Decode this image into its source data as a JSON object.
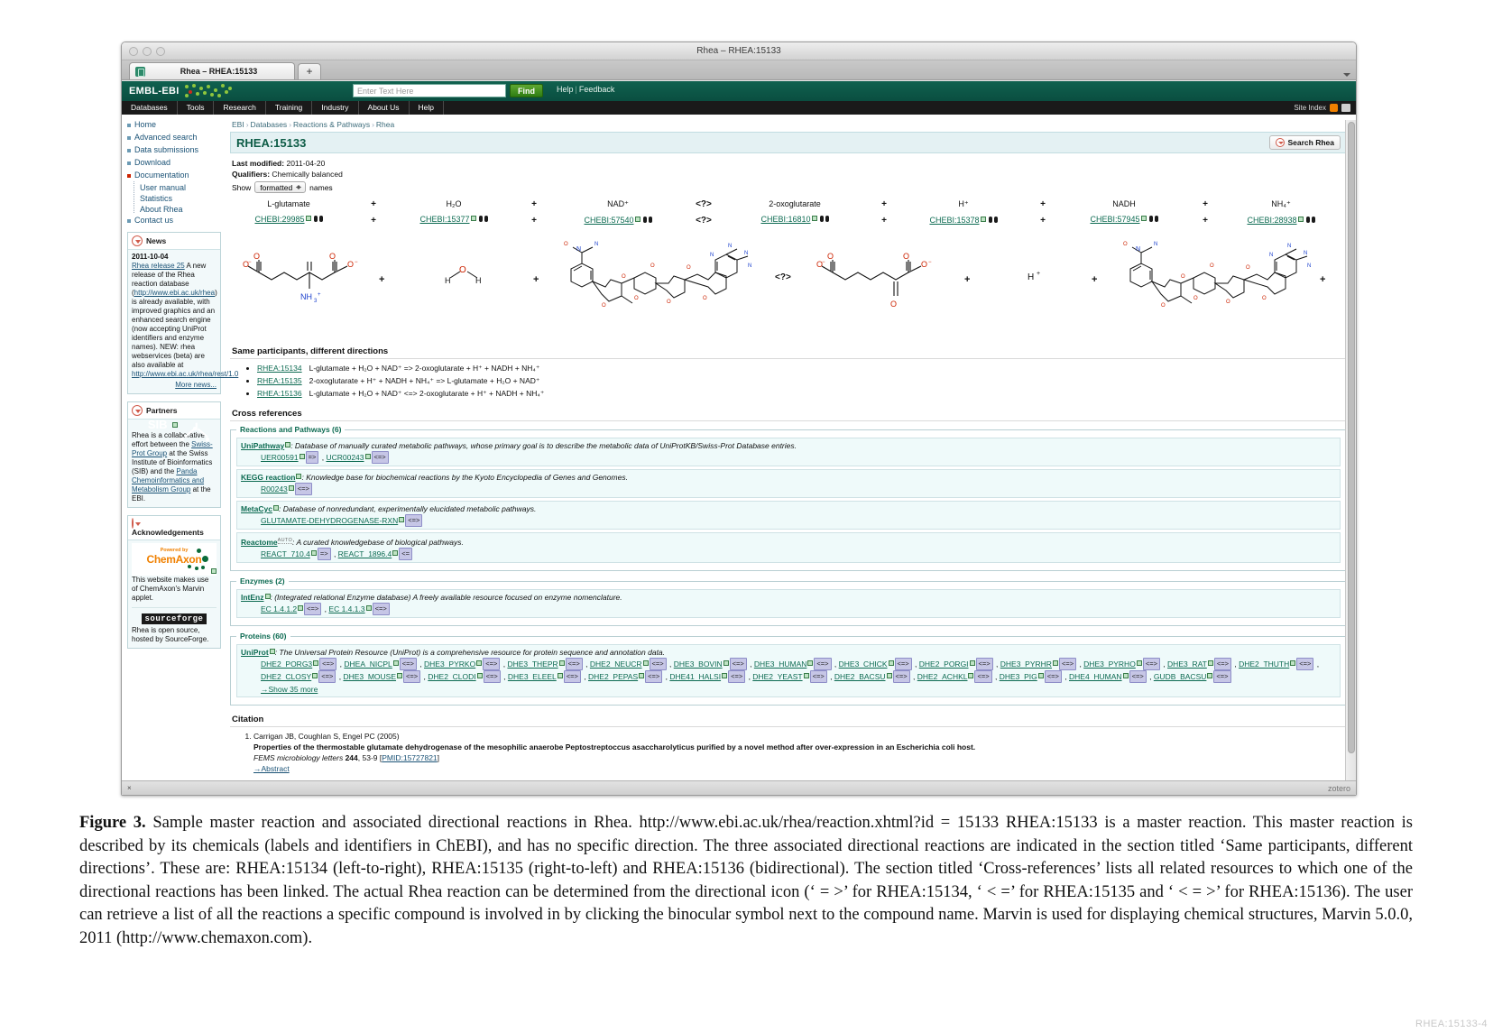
{
  "window": {
    "title": "Rhea – RHEA:15133",
    "tab_label": "Rhea – RHEA:15133",
    "new_tab_label": "+"
  },
  "ebi_header": {
    "logo": "EMBL-EBI",
    "search_placeholder": "Enter Text Here",
    "find_label": "Find",
    "help_label": "Help",
    "feedback_label": "Feedback",
    "nav": [
      "Databases",
      "Tools",
      "Research",
      "Training",
      "Industry",
      "About Us",
      "Help"
    ],
    "site_index_label": "Site Index"
  },
  "sidebar": {
    "links": [
      {
        "label": "Home",
        "active": false
      },
      {
        "label": "Advanced search",
        "active": false
      },
      {
        "label": "Data submissions",
        "active": false
      },
      {
        "label": "Download",
        "active": false
      },
      {
        "label": "Documentation",
        "active": true
      }
    ],
    "sublinks": [
      "User manual",
      "Statistics",
      "About Rhea"
    ],
    "contact": "Contact us",
    "news": {
      "title": "News",
      "date": "2011-10-04",
      "headline": "Rhea release 25",
      "text_1": "A new release of the Rhea reaction database (",
      "url_1": "http://www.ebi.ac.uk/rhea",
      "text_2": ") is already available, with improved graphics and an enhanced search engine (now accepting UniProt identifiers and enzyme names). NEW: rhea webservices (beta) are also available at ",
      "url_2": "http://www.ebi.ac.uk/rhea/rest/1.0",
      "more": "More news..."
    },
    "partners": {
      "title": "Partners",
      "logo_text": "SIB",
      "text_1": "Rhea is a collaborative effort between the ",
      "link_1": "Swiss-Prot Group",
      "text_2": " at the Swiss Institute of Bioinformatics (SIB) and the ",
      "link_2": "Panda Chemoinformatics and Metabolism Group",
      "text_3": " at the EBI."
    },
    "acknowledgements": {
      "title": "Acknowledgements",
      "powered_by": "Powered by",
      "brand": "ChemAxon",
      "text": "This website makes use of ChemAxon's Marvin applet.",
      "sourceforge_logo": "sourceforge",
      "sourceforge_text": "Rhea is open source, hosted by SourceForge."
    }
  },
  "main": {
    "breadcrumb": [
      "EBI",
      "Databases",
      "Reactions & Pathways",
      "Rhea"
    ],
    "page_title": "RHEA:15133",
    "search_rhea_label": "Search Rhea",
    "last_modified_label": "Last modified:",
    "last_modified_value": "2011-04-20",
    "qualifiers_label": "Qualifiers:",
    "qualifiers_value": "Chemically balanced",
    "show_label": "Show",
    "show_select_value": "formatted",
    "names_label": "names",
    "equation": {
      "left": [
        {
          "name": "L-glutamate",
          "id": "CHEBI:29985"
        },
        {
          "name": "H₂O",
          "id": "CHEBI:15377"
        },
        {
          "name": "NAD⁺",
          "id": "CHEBI:57540"
        }
      ],
      "direction": "<?>",
      "right": [
        {
          "name": "2-oxoglutarate",
          "id": "CHEBI:16810"
        },
        {
          "name": "H⁺",
          "id": "CHEBI:15378"
        },
        {
          "name": "NADH",
          "id": "CHEBI:57945"
        },
        {
          "name": "NH₄⁺",
          "id": "CHEBI:28938"
        }
      ],
      "plus": "+"
    },
    "directions_section": {
      "title": "Same participants, different directions",
      "items": [
        {
          "id": "RHEA:15134",
          "equation": "L-glutamate + H₂O + NAD⁺ => 2-oxoglutarate + H⁺ + NADH + NH₄⁺"
        },
        {
          "id": "RHEA:15135",
          "equation": "2-oxoglutarate + H⁺ + NADH + NH₄⁺ => L-glutamate + H₂O + NAD⁺"
        },
        {
          "id": "RHEA:15136",
          "equation": "L-glutamate + H₂O + NAD⁺ <=> 2-oxoglutarate + H⁺ + NADH + NH₄⁺"
        }
      ]
    },
    "cross_references": {
      "title": "Cross references",
      "groups": [
        {
          "legend": "Reactions and Pathways (6)",
          "rows": [
            {
              "db": "UniPathway",
              "desc": ": Database of manually curated metabolic pathways, whose primary goal is to describe the metabolic data of UniProtKB/Swiss-Prot Database entries.",
              "ids": [
                {
                  "id": "UER00591",
                  "dir": "=>"
                },
                {
                  "id": "UCR00243",
                  "dir": "<=>"
                }
              ]
            },
            {
              "db": "KEGG reaction",
              "desc": ": Knowledge base for biochemical reactions by the Kyoto Encyclopedia of Genes and Genomes.",
              "ids": [
                {
                  "id": "R00243",
                  "dir": "<=>"
                }
              ]
            },
            {
              "db": "MetaCyc",
              "desc": ": Database of nonredundant, experimentally elucidated metabolic pathways.",
              "ids": [
                {
                  "id": "GLUTAMATE-DEHYDROGENASE-RXN",
                  "dir": "<=>"
                }
              ]
            },
            {
              "db": "Reactome",
              "auto": "AUTO",
              "desc": ": A curated knowledgebase of biological pathways.",
              "ids": [
                {
                  "id": "REACT_710.4",
                  "dir": "=>"
                },
                {
                  "id": "REACT_1896.4",
                  "dir": "<="
                }
              ]
            }
          ]
        },
        {
          "legend": "Enzymes (2)",
          "rows": [
            {
              "db": "IntEnz",
              "desc": ": (Integrated relational Enzyme database) A freely available resource focused on enzyme nomenclature.",
              "ids": [
                {
                  "id": "EC 1.4.1.2",
                  "dir": "<=>"
                },
                {
                  "id": "EC 1.4.1.3",
                  "dir": "<=>"
                }
              ]
            }
          ]
        },
        {
          "legend": "Proteins (60)",
          "rows": [
            {
              "db": "UniProt",
              "desc": ": The Universal Protein Resource (UniProt) is a comprehensive resource for protein sequence and annotation data.",
              "ids": [
                {
                  "id": "DHE2_PORG3",
                  "dir": "<=>"
                },
                {
                  "id": "DHEA_NICPL",
                  "dir": "<=>"
                },
                {
                  "id": "DHE3_PYRKO",
                  "dir": "<=>"
                },
                {
                  "id": "DHE3_THEPR",
                  "dir": "<=>"
                },
                {
                  "id": "DHE2_NEUCR",
                  "dir": "<=>"
                },
                {
                  "id": "DHE3_BOVIN",
                  "dir": "<=>"
                },
                {
                  "id": "DHE3_HUMAN",
                  "dir": "<=>"
                },
                {
                  "id": "DHE3_CHICK",
                  "dir": "<=>"
                },
                {
                  "id": "DHE2_PORGI",
                  "dir": "<=>"
                },
                {
                  "id": "DHE3_PYRHR",
                  "dir": "<=>"
                },
                {
                  "id": "DHE3_PYRHO",
                  "dir": "<=>"
                },
                {
                  "id": "DHE3_RAT",
                  "dir": "<=>"
                },
                {
                  "id": "DHE2_THUTH",
                  "dir": "<=>"
                },
                {
                  "id": "DHE2_CLOSY",
                  "dir": "<=>"
                },
                {
                  "id": "DHE3_MOUSE",
                  "dir": "<=>"
                },
                {
                  "id": "DHE2_CLODI",
                  "dir": "<=>"
                },
                {
                  "id": "DHE3_ELEEL",
                  "dir": "<=>"
                },
                {
                  "id": "DHE2_PEPAS",
                  "dir": "<=>"
                },
                {
                  "id": "DHE41_HALSI",
                  "dir": "<=>"
                },
                {
                  "id": "DHE2_YEAST",
                  "dir": "<=>"
                },
                {
                  "id": "DHE2_BACSU",
                  "dir": "<=>"
                },
                {
                  "id": "DHE2_ACHKL",
                  "dir": "<=>"
                },
                {
                  "id": "DHE3_PIG",
                  "dir": "<=>"
                },
                {
                  "id": "DHE4_HUMAN",
                  "dir": "<=>"
                },
                {
                  "id": "GUDB_BACSU",
                  "dir": "<=>"
                }
              ],
              "show_more": "→Show 35 more"
            }
          ]
        }
      ]
    },
    "citation": {
      "title": "Citation",
      "number": "1.",
      "authors": "Carrigan JB, Coughlan S, Engel PC (2005)",
      "article_title": "Properties of the thermostable glutamate dehydrogenase of the mesophilic anaerobe Peptostreptoccus asaccharolyticus purified by a novel method after over-expression in an Escherichia coli host.",
      "journal": "FEMS microbiology letters",
      "volume": "244",
      "pages": ", 53-9 [",
      "pmid": "PMID:15727821",
      "pages_end": "]",
      "abstract_link": "→Abstract"
    }
  },
  "status": {
    "close_mark": "×",
    "zotero": "zotero"
  },
  "caption": {
    "label": "Figure 3.",
    "text": " Sample master reaction and associated directional reactions in Rhea. http://www.ebi.ac.uk/rhea/reaction.xhtml?id = 15133 RHEA:15133 is a master reaction. This master reaction is described by its chemicals (labels and identifiers in ChEBI), and has no specific direction. The three associated directional reactions are indicated in the section titled ‘Same participants, different directions’. These are: RHEA:15134 (left-to-right), RHEA:15135 (right-to-left) and RHEA:15136 (bidirectional). The section titled ‘Cross-references’ lists all related resources to which one of the directional reactions has been linked. The actual Rhea reaction can be determined from the directional icon (‘ = >’ for RHEA:15134, ‘ < =’ for RHEA:15135 and ‘ < = >’ for RHEA:15136). The user can retrieve a list of all the reactions a specific compound is involved in by clicking the binocular symbol next to the compound name. Marvin is used for displaying chemical structures, Marvin 5.0.0, 2011 (http://www.chemaxon.com)."
  },
  "watermark": "RHEA:15133-4"
}
